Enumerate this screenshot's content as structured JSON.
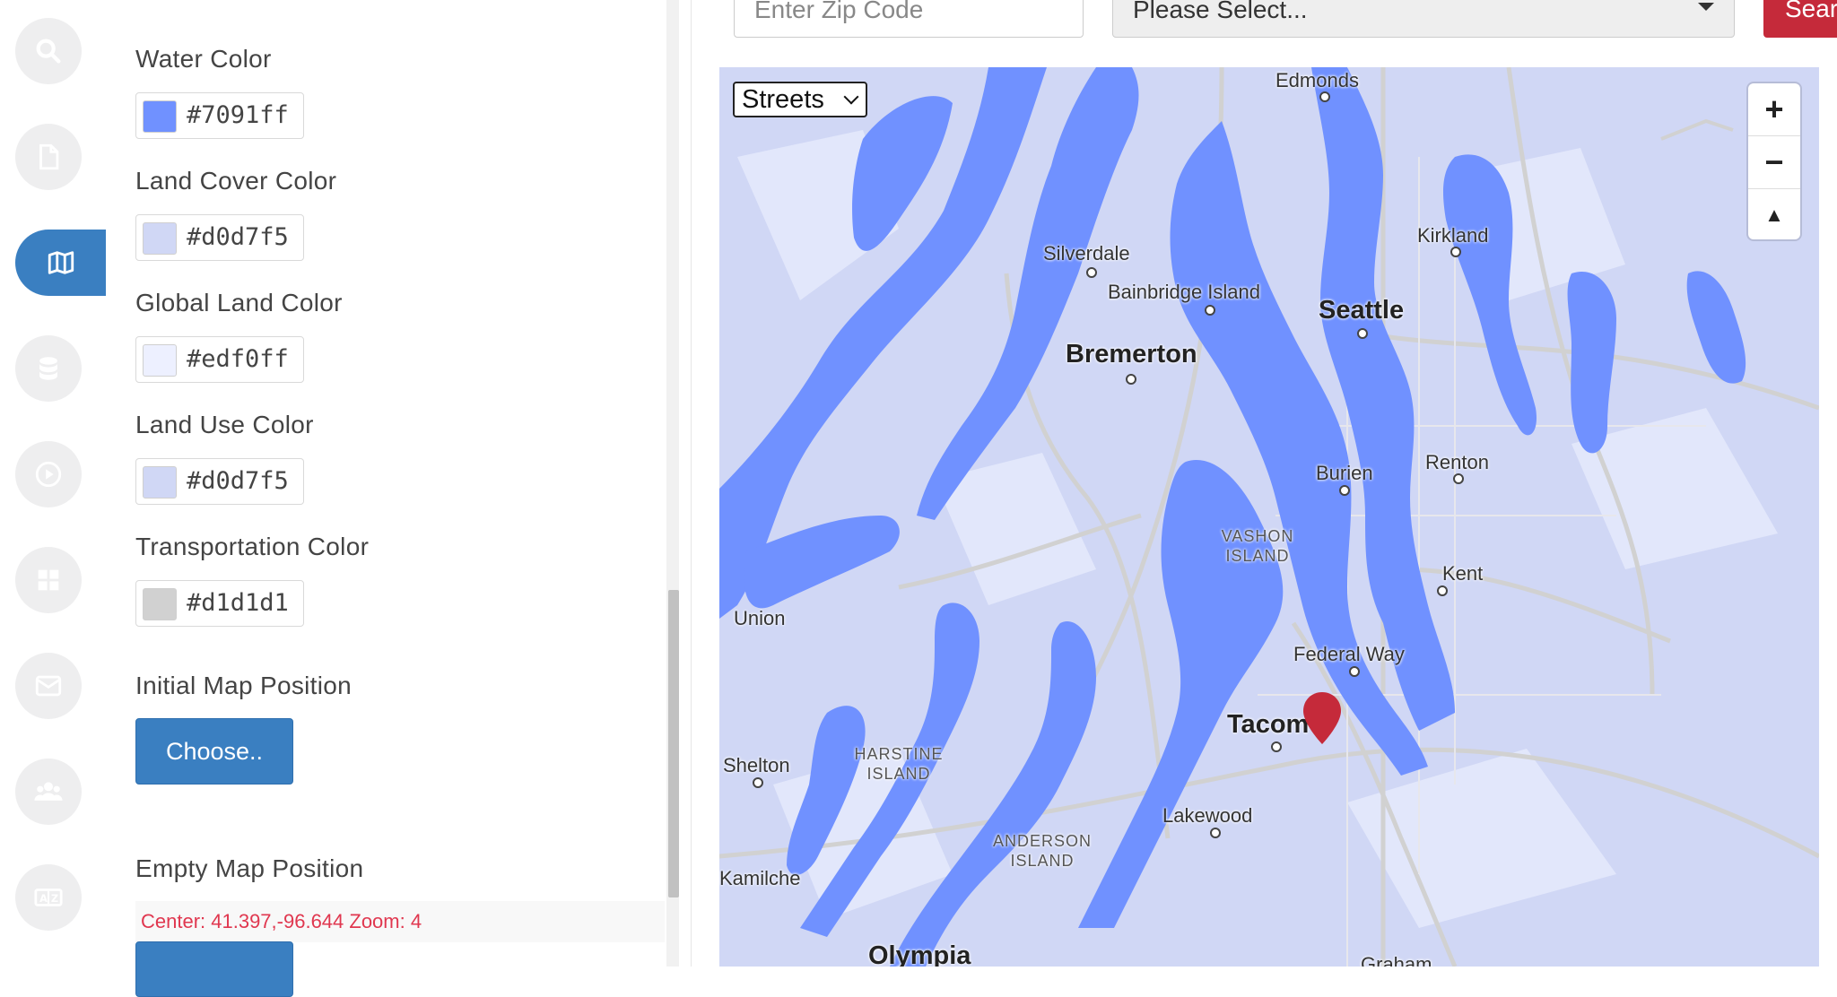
{
  "sidebar_icons": [
    "search-icon",
    "file-icon",
    "map-icon",
    "database-icon",
    "play-icon",
    "grid-icon",
    "mail-icon",
    "users-icon",
    "translate-icon"
  ],
  "colors": [
    {
      "label": "Water Color",
      "hex": "#7091ff"
    },
    {
      "label": "Land Cover Color",
      "hex": "#d0d7f5"
    },
    {
      "label": "Global Land Color",
      "hex": "#edf0ff"
    },
    {
      "label": "Land Use Color",
      "hex": "#d0d7f5"
    },
    {
      "label": "Transportation Color",
      "hex": "#d1d1d1"
    }
  ],
  "initial_position": {
    "label": "Initial Map Position",
    "button": "Choose.."
  },
  "empty_position": {
    "label": "Empty Map Position",
    "center_text": "Center: 41.397,-96.644 Zoom: 4"
  },
  "search": {
    "zip_placeholder": "Enter Zip Code",
    "select_value": "Please Select...",
    "button": "Sear"
  },
  "map": {
    "layer_select": "Streets",
    "zoom_in": "+",
    "zoom_out": "−",
    "reset": "▲",
    "places": [
      {
        "name": "Edmonds",
        "type": "normal"
      },
      {
        "name": "Silverdale",
        "type": "normal"
      },
      {
        "name": "Bainbridge Island",
        "type": "normal"
      },
      {
        "name": "Seattle",
        "type": "big"
      },
      {
        "name": "Kirkland",
        "type": "normal"
      },
      {
        "name": "Bremerton",
        "type": "big"
      },
      {
        "name": "Burien",
        "type": "normal"
      },
      {
        "name": "Renton",
        "type": "normal"
      },
      {
        "name": "VASHON ISLAND",
        "type": "small"
      },
      {
        "name": "Kent",
        "type": "normal"
      },
      {
        "name": "Union",
        "type": "normal"
      },
      {
        "name": "Federal Way",
        "type": "normal"
      },
      {
        "name": "Tacom",
        "type": "big"
      },
      {
        "name": "Shelton",
        "type": "normal"
      },
      {
        "name": "HARSTINE ISLAND",
        "type": "small"
      },
      {
        "name": "Lakewood",
        "type": "normal"
      },
      {
        "name": "ANDERSON ISLAND",
        "type": "small"
      },
      {
        "name": "Kamilche",
        "type": "normal"
      },
      {
        "name": "Olympia",
        "type": "big"
      },
      {
        "name": "Graham",
        "type": "normal"
      }
    ],
    "water_color": "#7091ff",
    "land_color": "#d0d7f5",
    "road_color": "#d1d1d1",
    "pin_color": "#c52a3a"
  }
}
